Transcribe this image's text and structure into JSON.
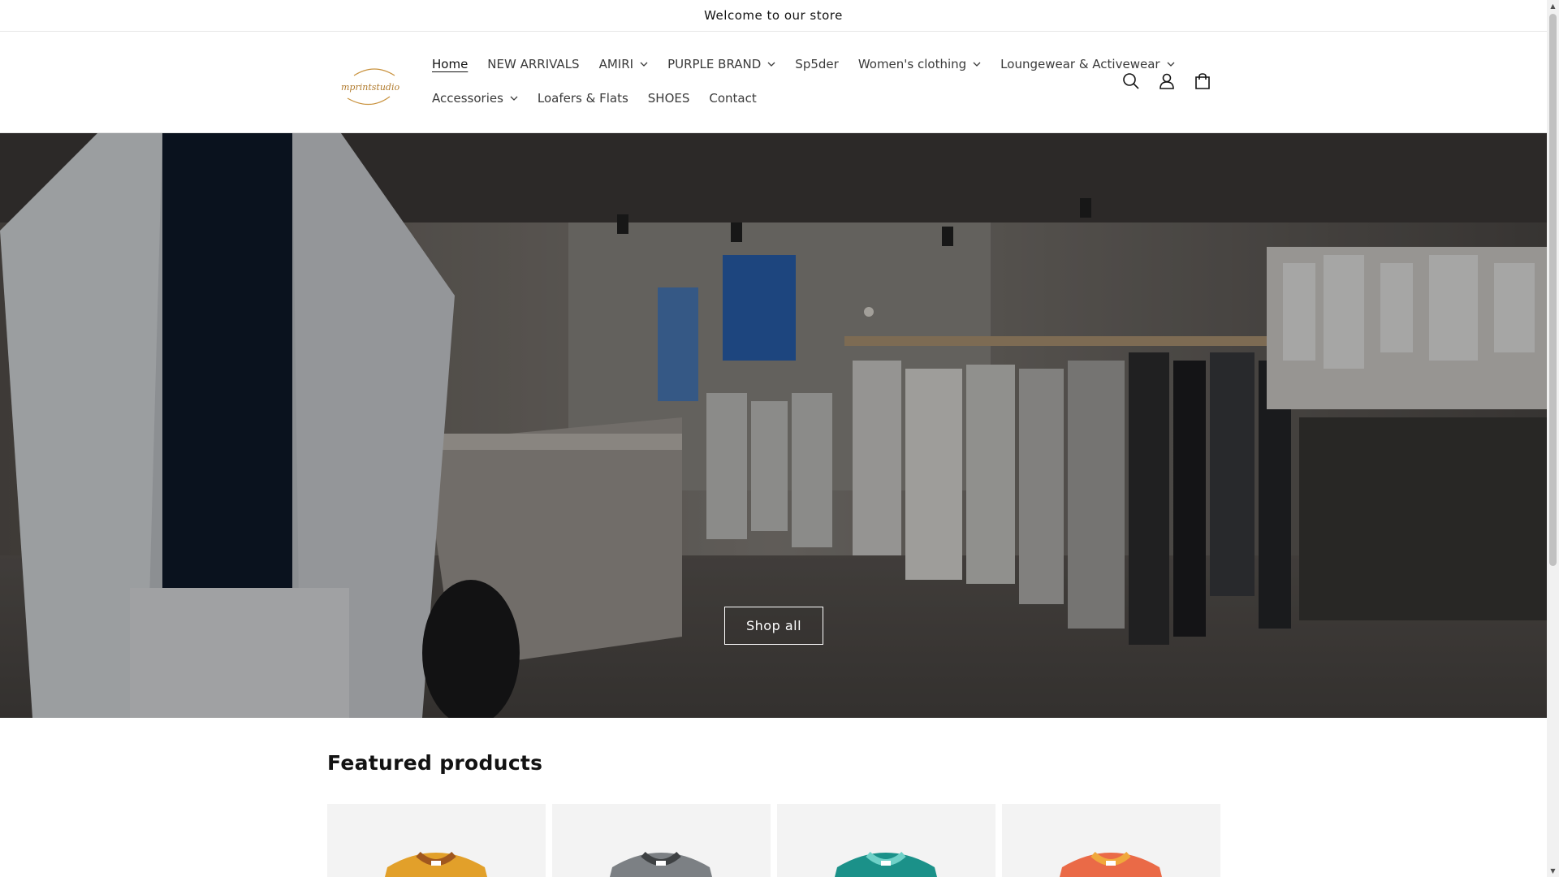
{
  "announcement": {
    "text": "Welcome to our store"
  },
  "header": {
    "logo_text": "mprintstudio",
    "nav_row1": [
      {
        "label": "Home",
        "has_dropdown": false,
        "active": true
      },
      {
        "label": "NEW ARRIVALS",
        "has_dropdown": false
      },
      {
        "label": "AMIRI",
        "has_dropdown": true
      },
      {
        "label": "PURPLE BRAND",
        "has_dropdown": true
      },
      {
        "label": "Sp5der",
        "has_dropdown": false
      },
      {
        "label": "Women's clothing",
        "has_dropdown": true
      },
      {
        "label": "Loungewear & Activewear",
        "has_dropdown": true
      }
    ],
    "nav_row2": [
      {
        "label": "Accessories",
        "has_dropdown": true
      },
      {
        "label": "Loafers & Flats",
        "has_dropdown": false
      },
      {
        "label": "SHOES",
        "has_dropdown": false
      },
      {
        "label": "Contact",
        "has_dropdown": false
      }
    ],
    "icons": [
      "search-icon",
      "account-icon",
      "cart-icon"
    ]
  },
  "hero": {
    "button_label": "Shop all"
  },
  "featured": {
    "title": "Featured products",
    "products": [
      {
        "color": "#e2a02a",
        "collar": "#a0571e"
      },
      {
        "color": "#7c8084",
        "collar": "#3e4143"
      },
      {
        "color": "#1b9189",
        "collar": "#6fd1c8"
      },
      {
        "color": "#ea6a47",
        "collar": "#f0a83c"
      }
    ]
  },
  "colors": {
    "text": "#121212",
    "border": "#e6e6e6",
    "logo_gold": "#c9923e"
  }
}
